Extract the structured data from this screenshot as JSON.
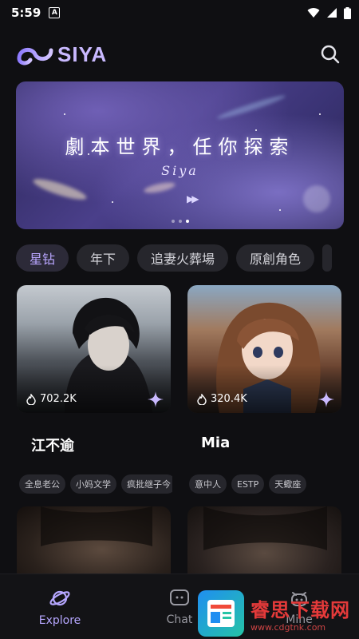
{
  "status_bar": {
    "time": "5:59",
    "badge": "A"
  },
  "app": {
    "name": "SIYA"
  },
  "banner": {
    "title": "劇本世界，任你探索",
    "subtitle": "Siya",
    "page_count": 3,
    "active_page": 3
  },
  "tags": [
    {
      "label": "星钻",
      "active": true
    },
    {
      "label": "年下"
    },
    {
      "label": "追妻火葬場"
    },
    {
      "label": "原創角色"
    }
  ],
  "cards": [
    {
      "likes": "702.2K",
      "name": "江不逾",
      "chips": [
        "全息老公",
        "小妈文学",
        "疯批继子今"
      ]
    },
    {
      "likes": "320.4K",
      "name": "Mia",
      "chips": [
        "意中人",
        "ESTP",
        "天蠍座"
      ]
    }
  ],
  "nav": [
    {
      "label": "Explore",
      "icon": "planet-icon",
      "active": true
    },
    {
      "label": "Chat",
      "icon": "chat-icon"
    },
    {
      "label": "Mine",
      "icon": "profile-icon"
    }
  ],
  "watermark": {
    "title": "睿思下载网",
    "url": "www.cdgtnk.com"
  },
  "colors": {
    "accent": "#b6a7ff",
    "background": "#0f0f12",
    "chip_bg": "#26262c"
  }
}
